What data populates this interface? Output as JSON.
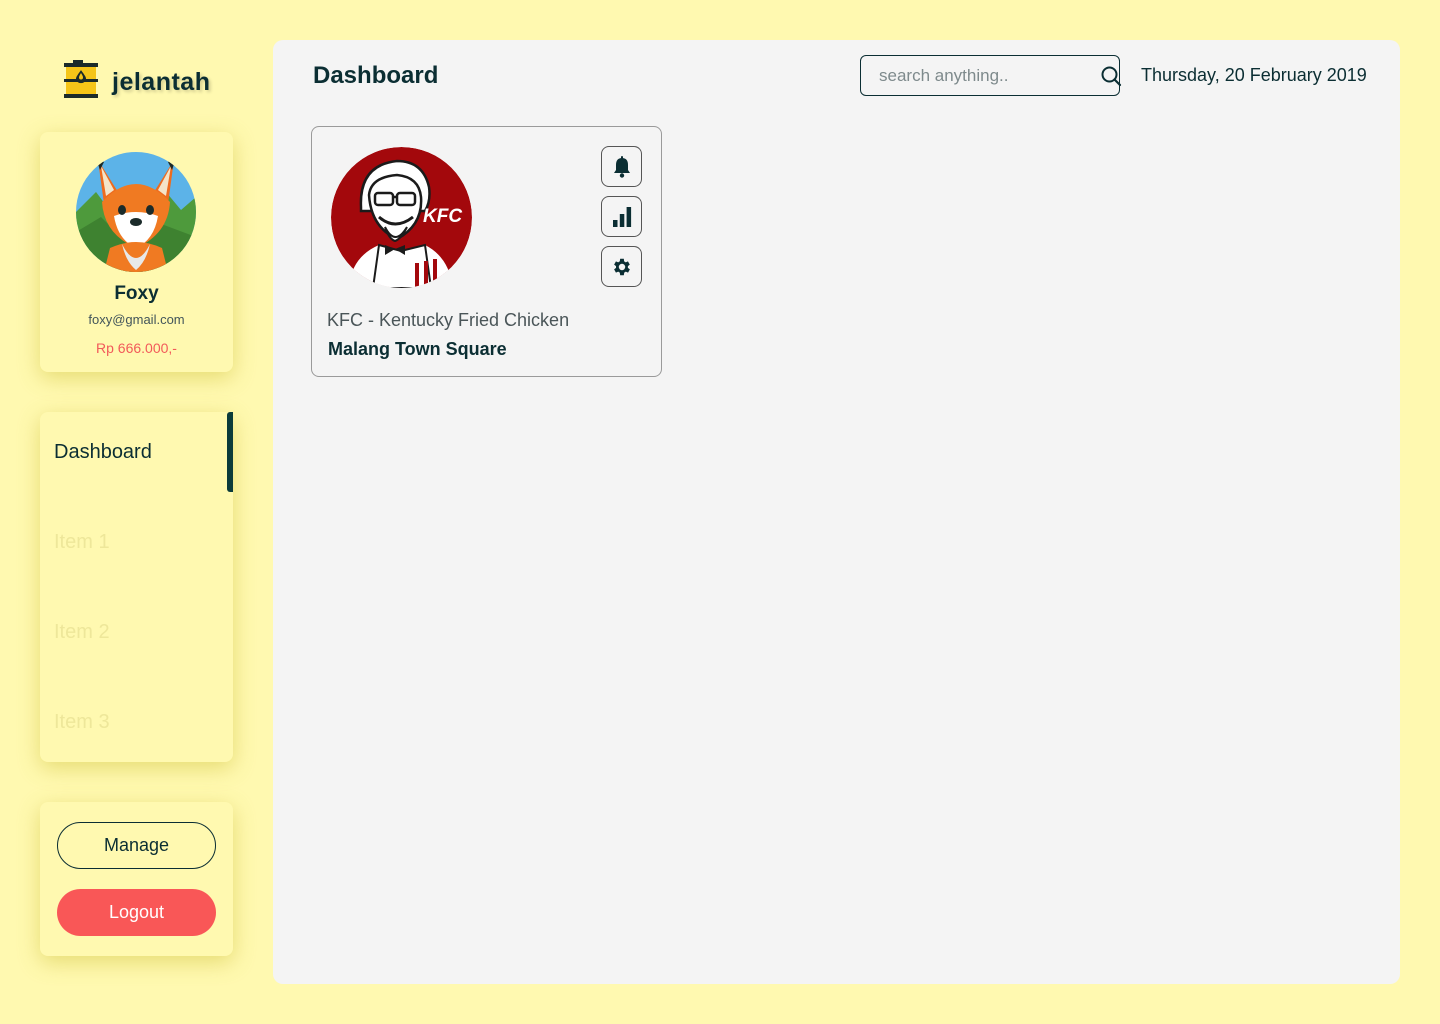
{
  "app": {
    "logo_text": "jelantah"
  },
  "profile": {
    "name": "Foxy",
    "email": "foxy@gmail.com",
    "balance": "Rp 666.000,-"
  },
  "sidebar": {
    "items": [
      {
        "label": "Dashboard",
        "active": true
      },
      {
        "label": "Item 1",
        "active": false
      },
      {
        "label": "Item 2",
        "active": false
      },
      {
        "label": "Item 3",
        "active": false
      }
    ],
    "manage_label": "Manage",
    "logout_label": "Logout"
  },
  "header": {
    "title": "Dashboard",
    "search_placeholder": "search anything..",
    "date": "Thursday, 20 February 2019"
  },
  "stores": [
    {
      "brand": "KFC - Kentucky Fried Chicken",
      "location": "Malang Town Square",
      "logo_text": "KFC",
      "actions": [
        "bell-icon",
        "bar-chart-icon",
        "gear-icon"
      ]
    }
  ],
  "colors": {
    "background": "#FFF9B0",
    "panel": "#F4F4F4",
    "primary_text": "#0B2E33",
    "balance": "#F25A5A",
    "logout": "#F95757",
    "kfc_red": "#A3080C"
  }
}
